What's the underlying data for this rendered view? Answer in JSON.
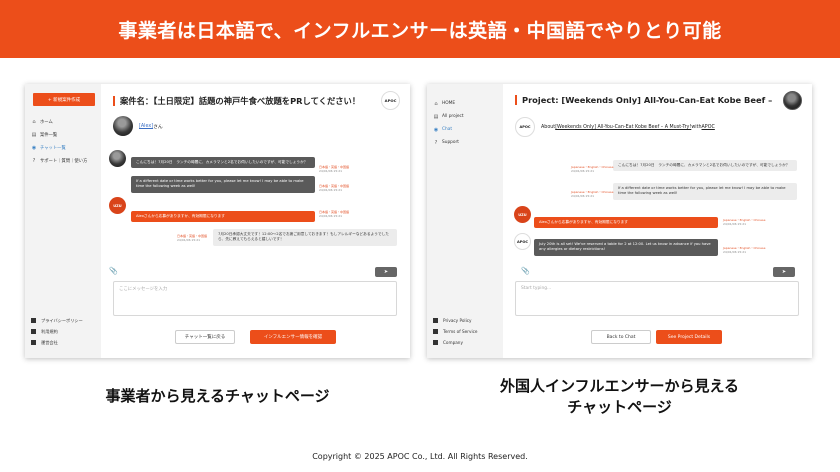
{
  "banner": {
    "title": "事業者は日本語で、インフルエンサーは英語・中国語でやりとり可能"
  },
  "jp": {
    "new_project_button": "+ 新規案件作成",
    "nav": [
      "ホーム",
      "案件一覧",
      "チャット一覧",
      "サポート｜質問｜使い方"
    ],
    "footer_links": [
      "プライバシーポリシー",
      "利用規約",
      "運営会社"
    ],
    "project_title": "案件名：【土日限定】話題の神戸牛食べ放題をPRしてください！",
    "top_avatar": "APOC",
    "partner_name": "[Alex]",
    "partner_suffix": " さん",
    "messages": [
      {
        "text": "こんにちは！7月20日　ランチの時間に、カメラマンと2名でお伺いしたいのですが、可能でしょうか？",
        "meta": [
          "日本語・英語・中国語",
          "24/01/06 15:21"
        ]
      },
      {
        "text": "If a different date or time works better for you, please let me know! I may be able to make time the following week as well!",
        "meta": [
          "日本語・英語・中国語",
          "24/01/06 15:21"
        ]
      },
      {
        "text": "Alexさんから応募がありますか、有効期限になります",
        "meta": [
          "日本語・英語・中国語",
          "24/01/06 15:21"
        ]
      },
      {
        "text": "7月20日承認大丈夫です！12:00～2名でお席ご用意しておきます！もしアレルギーなどあるようでしたら、先に教えてもらえると嬉しいです！",
        "meta": [
          "日本語・英語・中国語",
          "24/01/06 15:21"
        ]
      }
    ],
    "uzu_label": "UZU",
    "input_placeholder": "ここにメッセージを入力",
    "back_button": "チャット一覧に戻る",
    "influencer_button": "インフルエンサー情報を確認"
  },
  "en": {
    "nav": [
      "HOME",
      "All project",
      "Chat",
      "Support"
    ],
    "footer_links": [
      "Privacy Policy",
      "Terms of Service",
      "Company"
    ],
    "project_title": "Project: [Weekends Only] All-You-Can-Eat Kobe Beef – A Must-Try!",
    "about_prefix": "About ",
    "about_link": "[Weekends Only] All-You-Can-Eat Kobe Beef – A Must-Try!",
    "about_suffix": " with ",
    "about_company": "APOC",
    "apoc_label": "APOC",
    "uzu_label": "UZU",
    "messages": [
      {
        "text": "こんにちは！7月20日　ランチの時間に、カメラマンと2名でお伺いしたいのですが、可能でしょうか？",
        "meta": [
          "Japanese・English・Chinese",
          "24/01/06 15:21"
        ]
      },
      {
        "text": "If a different date or time works better for you, please let me know! I may be able to make time the following week as well!",
        "meta": [
          "Japanese・English・Chinese",
          "24/01/06 15:21"
        ]
      },
      {
        "text": "Alexさんから応募がありますか、有効期限になります",
        "meta": [
          "Japanese・English・Chinese",
          "24/01/06 15:21"
        ]
      },
      {
        "text": "July 20th is all set! We've reserved a table for 2 at 12:00. Let us know in advance if you have any allergies or dietary restrictions!",
        "meta": [
          "Japanese・English・Chinese",
          "24/01/06 15:21"
        ]
      }
    ],
    "input_placeholder": "Start typing...",
    "back_button": "Back to Chat",
    "details_button": "See Project Details"
  },
  "captions": {
    "left": "事業者から見えるチャットページ",
    "right_line1": "外国人インフルエンサーから見える",
    "right_line2": "チャットページ"
  },
  "copyright": "Copyright © 2025 APOC Co., Ltd. All Rights Reserved.",
  "icons": {
    "paperclip": "paperclip-icon",
    "send": "send-icon",
    "home": "home-icon",
    "list": "list-icon",
    "chat": "chat-icon",
    "help": "help-icon"
  },
  "colors": {
    "accent": "#ec4e1a",
    "link": "#3b6fc4",
    "bubble_dark": "#5a5a5a",
    "bubble_light": "#ececec"
  }
}
